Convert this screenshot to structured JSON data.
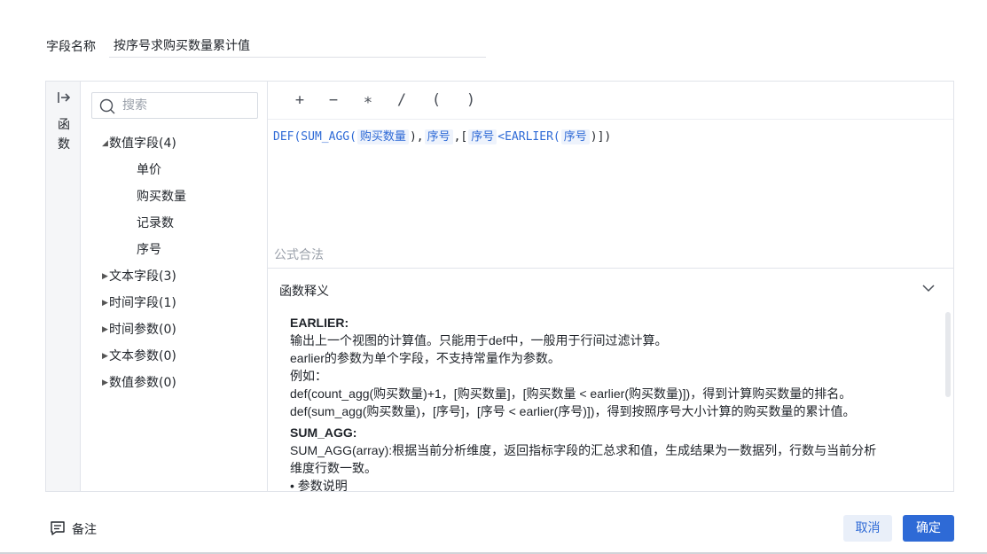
{
  "field": {
    "label": "字段名称",
    "value": "按序号求购买数量累计值"
  },
  "rail": {
    "label": "函数",
    "icon": "collapse-icon"
  },
  "search": {
    "placeholder": "搜索"
  },
  "tree": [
    {
      "label": "数值字段(4)",
      "expanded": true
    },
    {
      "label": "单价",
      "leaf": true
    },
    {
      "label": "购买数量",
      "leaf": true
    },
    {
      "label": "记录数",
      "leaf": true
    },
    {
      "label": "序号",
      "leaf": true
    },
    {
      "label": "文本字段(3)",
      "expanded": false
    },
    {
      "label": "时间字段(1)",
      "expanded": false
    },
    {
      "label": "时间参数(0)",
      "expanded": false
    },
    {
      "label": "文本参数(0)",
      "expanded": false
    },
    {
      "label": "数值参数(0)",
      "expanded": false
    }
  ],
  "operators": [
    "+",
    "−",
    "∗",
    "/",
    "(",
    ")"
  ],
  "formula": {
    "f1": "DEF(SUM_AGG(",
    "t1": "购买数量",
    "p1": "),",
    "t2": "序号",
    "p2": ",[",
    "t3": "序号",
    "p3": "<EARLIER(",
    "t4": "序号",
    "p4": ")])"
  },
  "status": "公式合法",
  "help": {
    "title": "函数释义",
    "earlier": {
      "name": "EARLIER:",
      "lines": [
        "输出上一个视图的计算值。只能用于def中，一般用于行间过滤计算。",
        "earlier的参数为单个字段，不支持常量作为参数。",
        "例如：",
        "def(count_agg(购买数量)+1，[购买数量]，[购买数量 < earlier(购买数量)])，得到计算购买数量的排名。",
        "def(sum_agg(购买数量)，[序号]，[序号 < earlier(序号)])，得到按照序号大小计算的购买数量的累计值。"
      ]
    },
    "sum_agg": {
      "name": "SUM_AGG:",
      "lines": [
        "SUM_AGG(array):根据当前分析维度，返回指标字段的汇总求和值，生成结果为一数据列，行数与当前分析",
        "维度行数一致。",
        "• 参数说明"
      ]
    }
  },
  "footer": {
    "note_label": "备注",
    "cancel_label": "取消",
    "ok_label": "确定"
  },
  "colors": {
    "accent": "#2e6ad6",
    "cancel_bg": "#e9eff9",
    "border": "#e1e4ea"
  }
}
